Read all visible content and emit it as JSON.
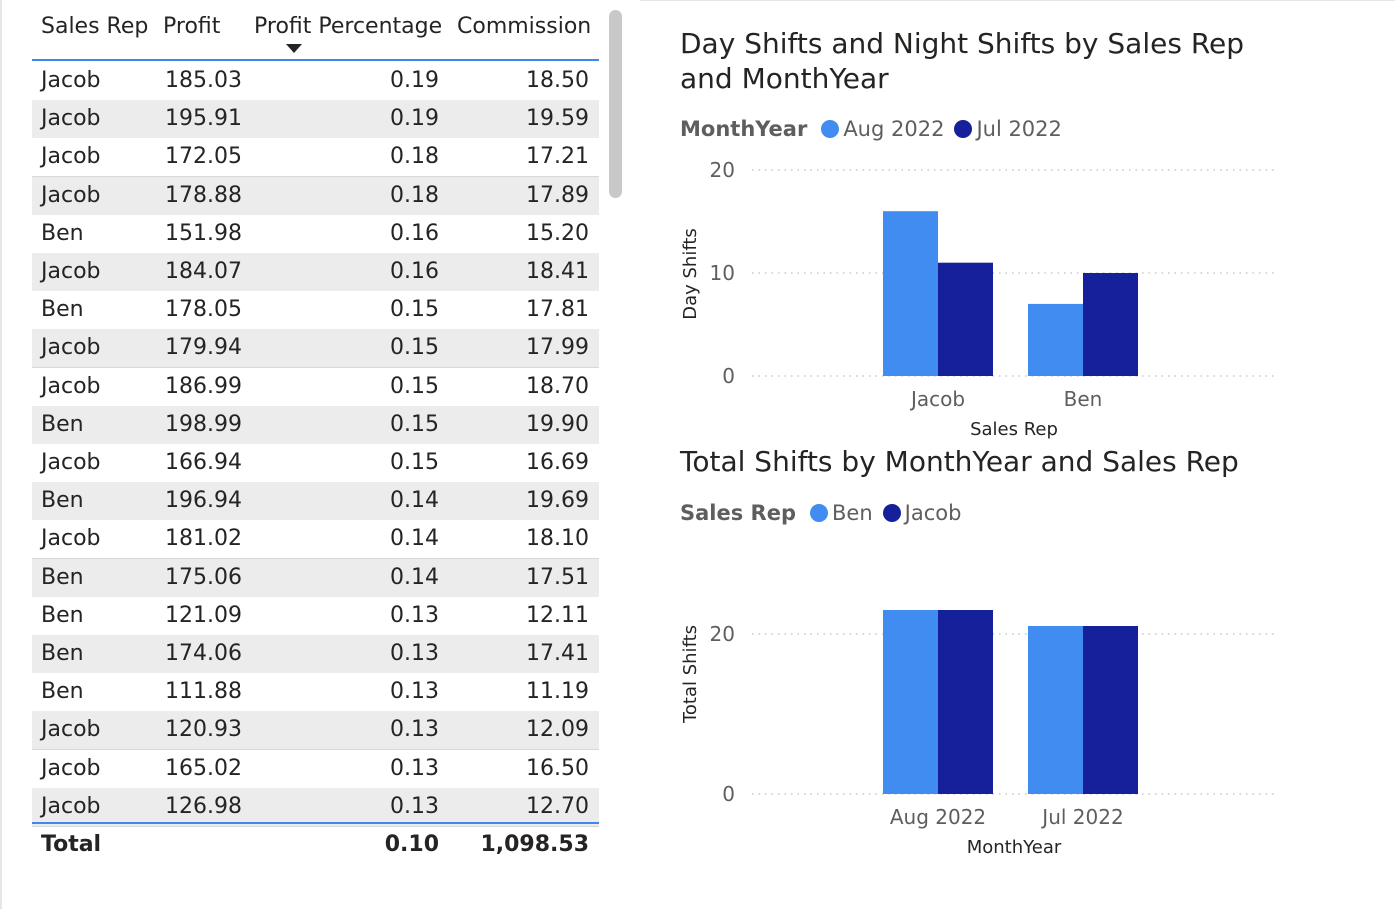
{
  "table": {
    "headers": {
      "sales_rep": "Sales Rep",
      "profit": "Profit",
      "profit_pct": "Profit Percentage",
      "commission": "Commission"
    },
    "sort_icon": "sort-descending-icon",
    "rows": [
      {
        "rep": "Jacob",
        "profit": "185.03",
        "pct": "0.19",
        "commission": "18.50"
      },
      {
        "rep": "Jacob",
        "profit": "195.91",
        "pct": "0.19",
        "commission": "19.59"
      },
      {
        "rep": "Jacob",
        "profit": "172.05",
        "pct": "0.18",
        "commission": "17.21"
      },
      {
        "rep": "Jacob",
        "profit": "178.88",
        "pct": "0.18",
        "commission": "17.89"
      },
      {
        "rep": "Ben",
        "profit": "151.98",
        "pct": "0.16",
        "commission": "15.20"
      },
      {
        "rep": "Jacob",
        "profit": "184.07",
        "pct": "0.16",
        "commission": "18.41"
      },
      {
        "rep": "Ben",
        "profit": "178.05",
        "pct": "0.15",
        "commission": "17.81"
      },
      {
        "rep": "Jacob",
        "profit": "179.94",
        "pct": "0.15",
        "commission": "17.99"
      },
      {
        "rep": "Jacob",
        "profit": "186.99",
        "pct": "0.15",
        "commission": "18.70"
      },
      {
        "rep": "Ben",
        "profit": "198.99",
        "pct": "0.15",
        "commission": "19.90"
      },
      {
        "rep": "Jacob",
        "profit": "166.94",
        "pct": "0.15",
        "commission": "16.69"
      },
      {
        "rep": "Ben",
        "profit": "196.94",
        "pct": "0.14",
        "commission": "19.69"
      },
      {
        "rep": "Jacob",
        "profit": "181.02",
        "pct": "0.14",
        "commission": "18.10"
      },
      {
        "rep": "Ben",
        "profit": "175.06",
        "pct": "0.14",
        "commission": "17.51"
      },
      {
        "rep": "Ben",
        "profit": "121.09",
        "pct": "0.13",
        "commission": "12.11"
      },
      {
        "rep": "Ben",
        "profit": "174.06",
        "pct": "0.13",
        "commission": "17.41"
      },
      {
        "rep": "Ben",
        "profit": "111.88",
        "pct": "0.13",
        "commission": "11.19"
      },
      {
        "rep": "Jacob",
        "profit": "120.93",
        "pct": "0.13",
        "commission": "12.09"
      },
      {
        "rep": "Jacob",
        "profit": "165.02",
        "pct": "0.13",
        "commission": "16.50"
      },
      {
        "rep": "Jacob",
        "profit": "126.98",
        "pct": "0.13",
        "commission": "12.70"
      }
    ],
    "total": {
      "label": "Total",
      "profit": "",
      "pct": "0.10",
      "commission": "1,098.53"
    }
  },
  "colors": {
    "light_blue": "#418cf0",
    "dark_blue": "#16209a",
    "accent_line": "#3f88e9"
  },
  "chart_data": [
    {
      "type": "bar",
      "title": "Day Shifts and Night Shifts by Sales Rep and MonthYear",
      "title_lines": [
        "Day Shifts and Night Shifts by Sales Rep",
        "and MonthYear"
      ],
      "legend_title": "MonthYear",
      "categories": [
        "Jacob",
        "Ben"
      ],
      "series": [
        {
          "name": "Aug 2022",
          "color": "#418cf0",
          "values": [
            16,
            7
          ]
        },
        {
          "name": "Jul 2022",
          "color": "#16209a",
          "values": [
            11,
            10
          ]
        }
      ],
      "xlabel": "Sales Rep",
      "ylabel": "Day Shifts",
      "ylim": [
        0,
        20
      ],
      "yticks": [
        0,
        10,
        20
      ],
      "grid": true,
      "legend_position": "top-left"
    },
    {
      "type": "bar",
      "title": "Total Shifts by MonthYear and Sales Rep",
      "title_lines": [
        "Total Shifts by MonthYear and Sales Rep"
      ],
      "legend_title": "Sales Rep",
      "categories": [
        "Aug 2022",
        "Jul 2022"
      ],
      "series": [
        {
          "name": "Ben",
          "color": "#418cf0",
          "values": [
            23,
            21
          ]
        },
        {
          "name": "Jacob",
          "color": "#16209a",
          "values": [
            23,
            21
          ]
        }
      ],
      "xlabel": "MonthYear",
      "ylabel": "Total Shifts",
      "ylim": [
        0,
        20
      ],
      "yticks": [
        0,
        20
      ],
      "grid": true,
      "legend_position": "top-left"
    }
  ]
}
